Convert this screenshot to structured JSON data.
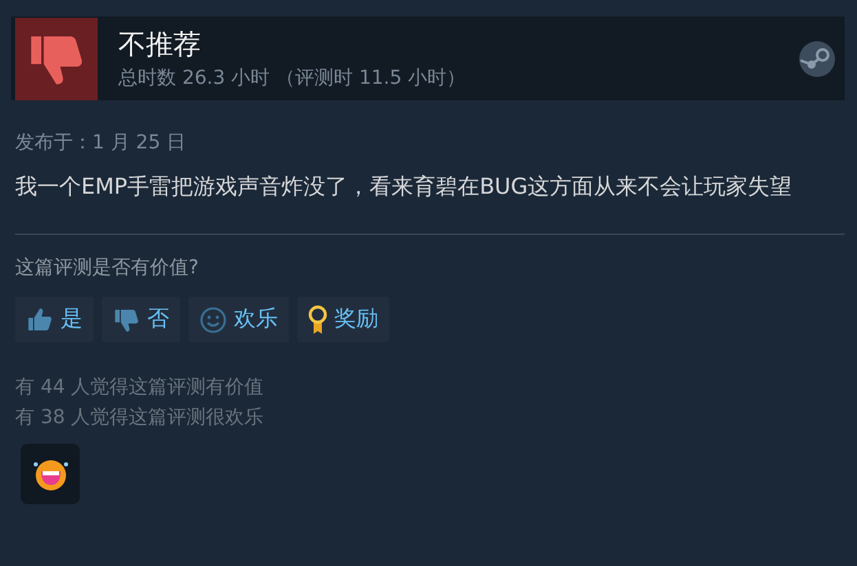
{
  "review": {
    "verdict": "不推荐",
    "playtime": "总时数 26.3 小时 （评测时 11.5 小时）",
    "recommended": false
  },
  "posted": "发布于：1 月 25 日",
  "body": "我一个EMP手雷把游戏声音炸没了，看来育碧在BUG这方面从来不会让玩家失望",
  "question": "这篇评测是否有价值?",
  "buttons": [
    {
      "kind": "yes",
      "label": "是"
    },
    {
      "kind": "no",
      "label": "否"
    },
    {
      "kind": "funny",
      "label": "欢乐"
    },
    {
      "kind": "award",
      "label": "奖励"
    }
  ],
  "stats": [
    "有 44 人觉得这篇评测有价值",
    "有 38 人觉得这篇评测很欢乐"
  ],
  "awards": [
    {
      "kind": "laughing"
    }
  ]
}
